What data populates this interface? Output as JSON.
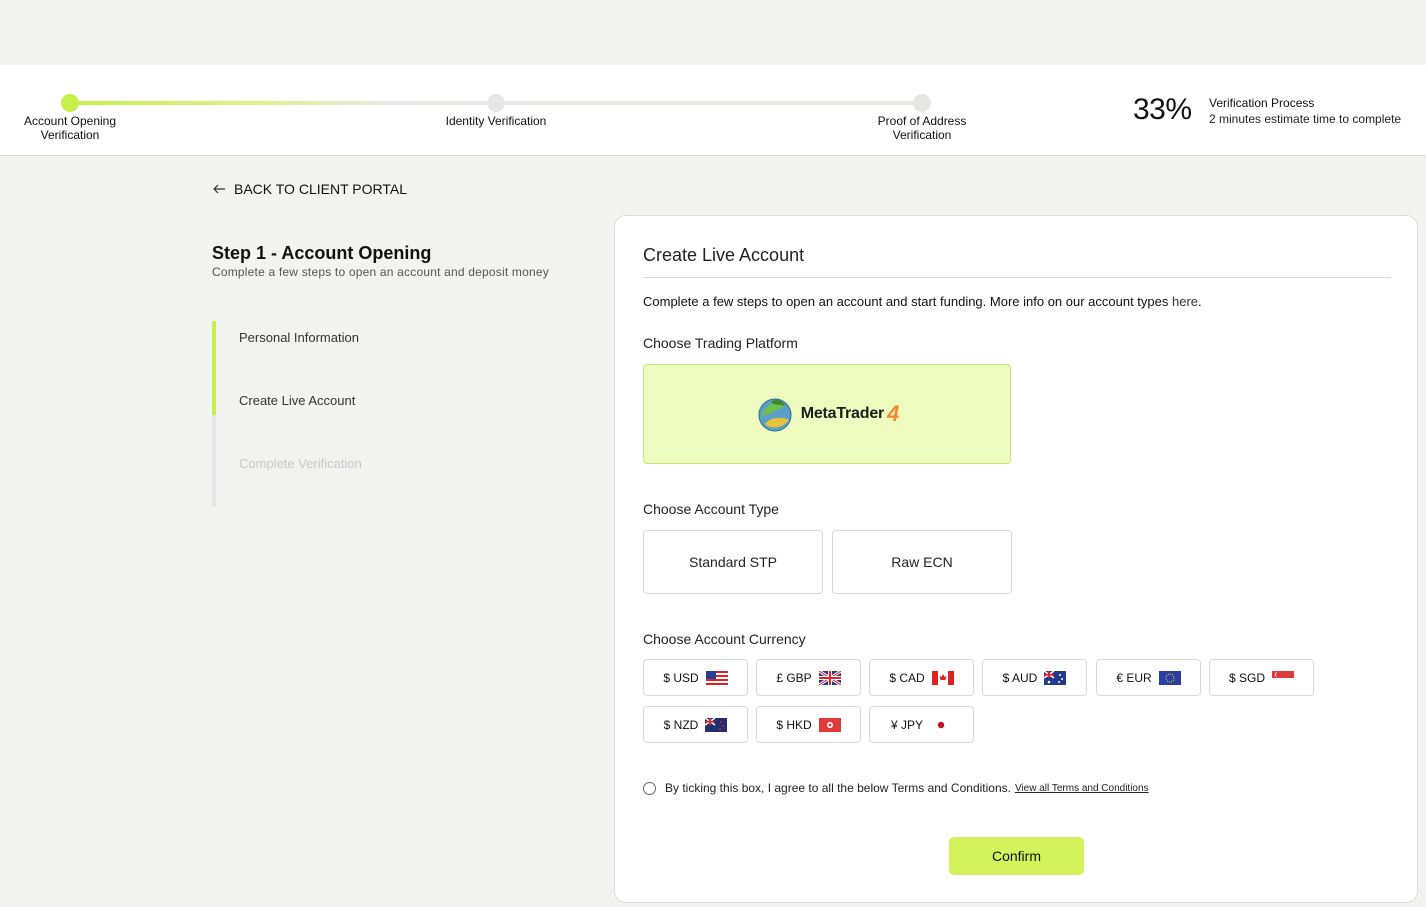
{
  "progress": {
    "steps": [
      {
        "label": "Account Opening\nVerification"
      },
      {
        "label": "Identity Verification"
      },
      {
        "label": "Proof of Address\nVerification"
      }
    ],
    "percent": "33%",
    "title": "Verification Process",
    "subtitle": "2 minutes estimate time to complete"
  },
  "nav": {
    "back_label": "BACK TO CLIENT PORTAL"
  },
  "step": {
    "title": "Step 1 - Account Opening",
    "subtitle": "Complete a few steps to open an account and deposit money",
    "items": [
      {
        "label": "Personal Information"
      },
      {
        "label": "Create Live Account"
      },
      {
        "label": "Complete Verification"
      }
    ]
  },
  "card": {
    "title": "Create Live Account",
    "intro": "Complete a few steps to open an account and start funding. More info on our account types",
    "intro_link": "here",
    "intro_end": ".",
    "platform_label": "Choose Trading Platform",
    "platform": {
      "name": "MetaTrader",
      "version": "4"
    },
    "account_type_label": "Choose Account Type",
    "account_types": [
      "Standard STP",
      "Raw ECN"
    ],
    "currency_label": "Choose Account Currency",
    "currencies": [
      {
        "label": "$ USD",
        "flag": "us-flag-icon"
      },
      {
        "label": "£ GBP",
        "flag": "uk-flag-icon"
      },
      {
        "label": "$ CAD",
        "flag": "ca-flag-icon"
      },
      {
        "label": "$ AUD",
        "flag": "au-flag-icon"
      },
      {
        "label": "€ EUR",
        "flag": "eu-flag-icon"
      },
      {
        "label": "$ SGD",
        "flag": "sg-flag-icon"
      },
      {
        "label": "$ NZD",
        "flag": "nz-flag-icon"
      },
      {
        "label": "$ HKD",
        "flag": "hk-flag-icon"
      },
      {
        "label": "¥ JPY",
        "flag": "jp-flag-icon"
      }
    ],
    "terms_text": "By ticking this box, I agree to all the below Terms and Conditions.",
    "terms_link": "View all Terms and Conditions",
    "confirm_label": "Confirm"
  },
  "colors": {
    "accent": "#c6f04a",
    "button": "#d4f25c",
    "platform_bg": "#eefcc0"
  }
}
